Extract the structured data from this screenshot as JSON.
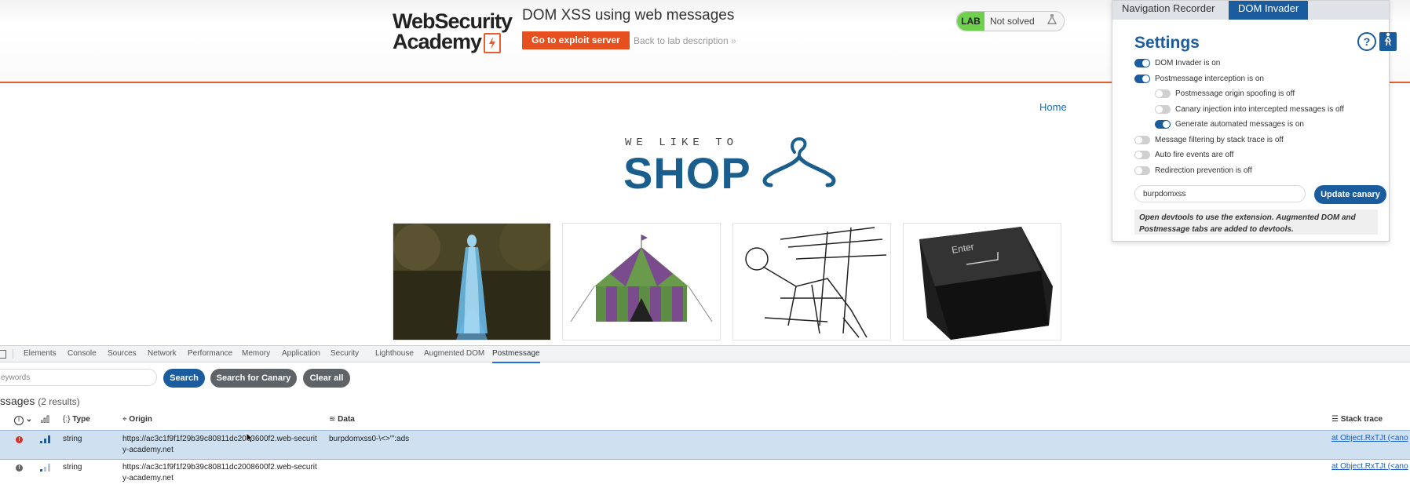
{
  "header": {
    "logo_line1": "WebSecurity",
    "logo_line2": "Academy",
    "lab_title": "DOM XSS using web messages",
    "exploit_button": "Go to exploit server",
    "back_link": "Back to lab description",
    "lab_badge": "LAB",
    "lab_status": "Not solved"
  },
  "page": {
    "nav_home": "Home",
    "tagline": "WE LIKE TO",
    "brand": "SHOP",
    "products": [
      {
        "name": "ghost-dress-image"
      },
      {
        "name": "tent-image"
      },
      {
        "name": "sketch-image"
      },
      {
        "name": "enter-key-image",
        "key_label": "Enter"
      }
    ]
  },
  "extension": {
    "tabs": [
      "Navigation Recorder",
      "DOM Invader"
    ],
    "active_tab": "DOM Invader",
    "settings_title": "Settings",
    "options": [
      {
        "label": "DOM Invader is on",
        "on": true,
        "indent": 0
      },
      {
        "label": "Postmessage interception is on",
        "on": true,
        "indent": 0
      },
      {
        "label": "Postmessage origin spoofing is off",
        "on": false,
        "indent": 1
      },
      {
        "label": "Canary injection into intercepted messages is off",
        "on": false,
        "indent": 1
      },
      {
        "label": "Generate automated messages is on",
        "on": true,
        "indent": 1
      },
      {
        "label": "Message filtering by stack trace is off",
        "on": false,
        "indent": 0
      },
      {
        "label": "Auto fire events are off",
        "on": false,
        "indent": 0
      },
      {
        "label": "Redirection prevention is off",
        "on": false,
        "indent": 0
      }
    ],
    "canary_value": "burpdomxss",
    "update_button": "Update canary",
    "note": "Open devtools to use the extension. Augmented DOM and Postmessage tabs are added to devtools."
  },
  "devtools": {
    "tabs": [
      "Elements",
      "Console",
      "Sources",
      "Network",
      "Performance",
      "Memory",
      "Application",
      "Security",
      "Lighthouse",
      "Augmented DOM",
      "Postmessage"
    ],
    "active_tab": "Postmessage",
    "search_placeholder": "eywords",
    "search_button": "Search",
    "canary_button": "Search for Canary",
    "clear_button": "Clear all",
    "messages_title": "ssages",
    "messages_count": "(2 results)",
    "columns": {
      "type": "Type",
      "origin": "Origin",
      "data": "Data",
      "stack": "Stack trace"
    },
    "rows": [
      {
        "severity": "!",
        "severity_color": "#d93025",
        "type": "string",
        "origin_line1": "https://ac3c1f9f1f29b39c80811dc2008600f2.web-securit",
        "origin_line2": "y-academy.net",
        "data": "burpdomxss0-\\<>\"':ads",
        "stack": "at Object.RxTJt (<ano",
        "selected": true
      },
      {
        "severity": "!",
        "severity_color": "#666666",
        "type": "string",
        "origin_line1": "https://ac3c1f9f1f29b39c80811dc2008600f2.web-securit",
        "origin_line2": "y-academy.net",
        "data": "",
        "stack": "at Object.RxTJt (<ano",
        "selected": false
      }
    ]
  }
}
